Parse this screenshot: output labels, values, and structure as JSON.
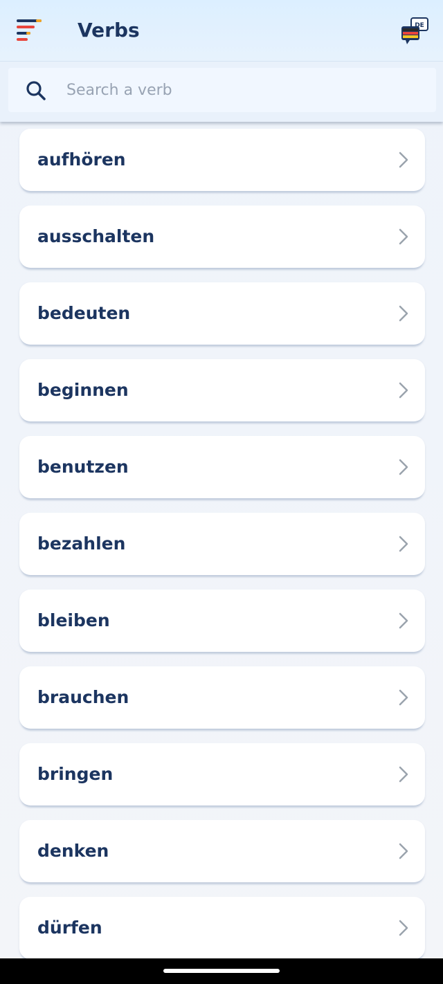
{
  "header": {
    "title": "Verbs",
    "menu_icon": "hamburger-menu-icon",
    "language_icon": "language-flag-icon",
    "language_badge": "DE"
  },
  "search": {
    "placeholder": "Search a verb",
    "value": "",
    "icon": "search-icon"
  },
  "verbs": [
    "aufhören",
    "ausschalten",
    "bedeuten",
    "beginnen",
    "benutzen",
    "bezahlen",
    "bleiben",
    "brauchen",
    "bringen",
    "denken",
    "dürfen"
  ],
  "colors": {
    "text_primary": "#1c3560",
    "chevron": "#9aa3ad",
    "header_bg": "#dcefff",
    "accent_red": "#e8453c",
    "accent_orange": "#f5a623"
  }
}
